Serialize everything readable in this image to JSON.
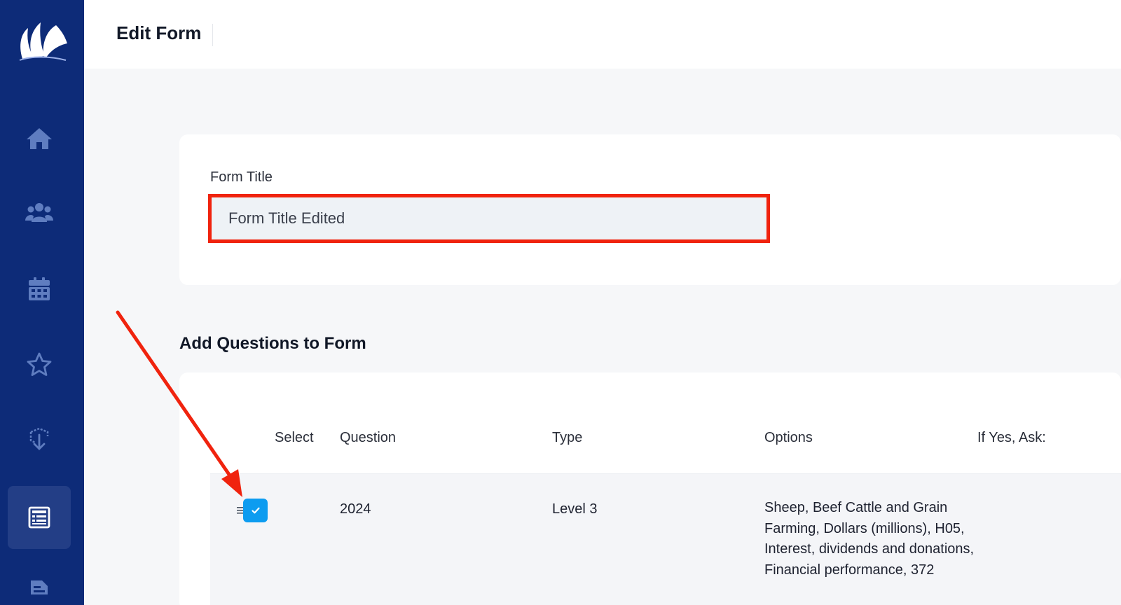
{
  "header": {
    "title": "Edit Form"
  },
  "sidebar": {
    "items": [
      {
        "icon": "home-icon"
      },
      {
        "icon": "users-icon"
      },
      {
        "icon": "calendar-icon"
      },
      {
        "icon": "star-icon"
      },
      {
        "icon": "import-icon"
      },
      {
        "icon": "form-icon",
        "active": true
      },
      {
        "icon": "document-icon"
      }
    ]
  },
  "form": {
    "title_label": "Form Title",
    "title_value": "Form Title Edited"
  },
  "questions": {
    "heading": "Add Questions to Form",
    "columns": [
      "Select",
      "Question",
      "Type",
      "Options",
      "If Yes, Ask:"
    ],
    "rows": [
      {
        "selected": true,
        "question": "2024",
        "type": "Level 3",
        "options": "Sheep, Beef Cattle and Grain Farming, Dollars (millions), H05, Interest, dividends and donations, Financial performance, 372",
        "if_yes_ask": ""
      }
    ]
  },
  "colors": {
    "sidebar_bg": "#0d2b78",
    "highlight": "#f0230e",
    "checkbox": "#0d9cf0"
  }
}
